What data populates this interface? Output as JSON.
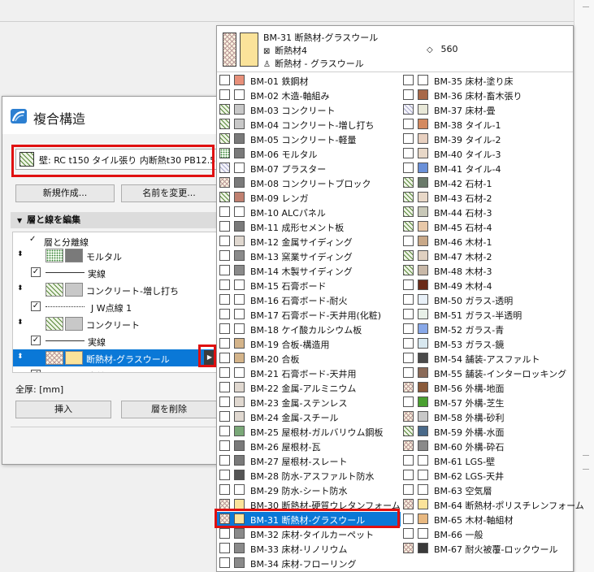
{
  "dialog": {
    "title": "複合構造",
    "structure_name": "壁: RC t150 タイル張り 内断熱t30 PB12.5",
    "new_button": "新規作成...",
    "rename_button": "名前を変更...",
    "section_label": "層と線を編集",
    "layers": [
      {
        "label": "層と分離線",
        "kind": "header"
      },
      {
        "label": "モルタル",
        "kind": "layer",
        "fill": "#7a7a7a",
        "hatch": "dots"
      },
      {
        "label": "実線",
        "kind": "line"
      },
      {
        "label": "コンクリート-増し打ち",
        "kind": "layer",
        "fill": "#c8c8c8",
        "hatch": "diag"
      },
      {
        "label": "J W点線 1",
        "kind": "line"
      },
      {
        "label": "コンクリート",
        "kind": "layer",
        "fill": "#c8c8c8",
        "hatch": "diag"
      },
      {
        "label": "実線",
        "kind": "line"
      },
      {
        "label": "断熱材-グラスウール",
        "kind": "layer",
        "fill": "#fbe39a",
        "hatch": "plus",
        "selected": true
      },
      {
        "label": "実線",
        "kind": "line"
      }
    ],
    "thickness_label": "全厚: [mm]",
    "insert_button": "挿入",
    "delete_button": "層を削除"
  },
  "popup": {
    "header": {
      "name": "BM-31  断熱材-グラスウール",
      "line2": "断熱材4",
      "line3": "断熱材 - グラスウール",
      "value": "560"
    },
    "left_column": [
      {
        "code": "BM-01",
        "name": "鉄鋼材",
        "color": "#e8907a",
        "hatch": "none"
      },
      {
        "code": "BM-02",
        "name": "木造-軸組み",
        "color": "#ffffff",
        "hatch": "none"
      },
      {
        "code": "BM-03",
        "name": "コンクリート",
        "color": "#c8c8c8",
        "hatch": "diag"
      },
      {
        "code": "BM-04",
        "name": "コンクリート-増し打ち",
        "color": "#c8c8c8",
        "hatch": "diag"
      },
      {
        "code": "BM-05",
        "name": "コンクリート-軽量",
        "color": "#7a7a7a",
        "hatch": "diag"
      },
      {
        "code": "BM-06",
        "name": "モルタル",
        "color": "#7a7a7a",
        "hatch": "dots"
      },
      {
        "code": "BM-07",
        "name": "プラスター",
        "color": "#ffffff",
        "hatch": "light"
      },
      {
        "code": "BM-08",
        "name": "コンクリートブロック",
        "color": "#7a7a7a",
        "hatch": "plus"
      },
      {
        "code": "BM-09",
        "name": "レンガ",
        "color": "#c08070",
        "hatch": "diag"
      },
      {
        "code": "BM-10",
        "name": "ALCパネル",
        "color": "#ffffff",
        "hatch": "none"
      },
      {
        "code": "BM-11",
        "name": "成形セメント板",
        "color": "#7a7a7a",
        "hatch": "none"
      },
      {
        "code": "BM-12",
        "name": "金属サイディング",
        "color": "#e0d8d0",
        "hatch": "none"
      },
      {
        "code": "BM-13",
        "name": "窯業サイディング",
        "color": "#8a8a8a",
        "hatch": "none"
      },
      {
        "code": "BM-14",
        "name": "木製サイディング",
        "color": "#8a8a8a",
        "hatch": "none"
      },
      {
        "code": "BM-15",
        "name": "石膏ボード",
        "color": "#ffffff",
        "hatch": "none"
      },
      {
        "code": "BM-16",
        "name": "石膏ボード-耐火",
        "color": "#ffffff",
        "hatch": "none"
      },
      {
        "code": "BM-17",
        "name": "石膏ボード-天井用(化粧)",
        "color": "#ffffff",
        "hatch": "none"
      },
      {
        "code": "BM-18",
        "name": "ケイ酸カルシウム板",
        "color": "#ffffff",
        "hatch": "none"
      },
      {
        "code": "BM-19",
        "name": "合板-構造用",
        "color": "#d4b48a",
        "hatch": "none"
      },
      {
        "code": "BM-20",
        "name": "合板",
        "color": "#d4b48a",
        "hatch": "none"
      },
      {
        "code": "BM-21",
        "name": "石膏ボード-天井用",
        "color": "#ffffff",
        "hatch": "none"
      },
      {
        "code": "BM-22",
        "name": "金属-アルミニウム",
        "color": "#e0d8d0",
        "hatch": "none"
      },
      {
        "code": "BM-23",
        "name": "金属-ステンレス",
        "color": "#e0d8d0",
        "hatch": "none"
      },
      {
        "code": "BM-24",
        "name": "金属-スチール",
        "color": "#e0d8d0",
        "hatch": "none"
      },
      {
        "code": "BM-25",
        "name": "屋根材-ガルバリウム鋼板",
        "color": "#7aa878",
        "hatch": "none"
      },
      {
        "code": "BM-26",
        "name": "屋根材-瓦",
        "color": "#7a7a7a",
        "hatch": "none"
      },
      {
        "code": "BM-27",
        "name": "屋根材-スレート",
        "color": "#7a7a7a",
        "hatch": "none"
      },
      {
        "code": "BM-28",
        "name": "防水-アスファルト防水",
        "color": "#555555",
        "hatch": "none"
      },
      {
        "code": "BM-29",
        "name": "防水-シート防水",
        "color": "#ffffff",
        "hatch": "none"
      },
      {
        "code": "BM-30",
        "name": "断熱材-硬質ウレタンフォーム",
        "color": "#fbe39a",
        "hatch": "plus"
      },
      {
        "code": "BM-31",
        "name": "断熱材-グラスウール",
        "color": "#fbe39a",
        "hatch": "plus",
        "selected": true
      },
      {
        "code": "BM-32",
        "name": "床材-タイルカーペット",
        "color": "#8a8a8a",
        "hatch": "none"
      },
      {
        "code": "BM-33",
        "name": "床材-リノリウム",
        "color": "#8a8a8a",
        "hatch": "none"
      },
      {
        "code": "BM-34",
        "name": "床材-フローリング",
        "color": "#8a8a8a",
        "hatch": "none"
      }
    ],
    "right_column": [
      {
        "code": "BM-35",
        "name": "床材-塗り床",
        "color": "#ffffff",
        "hatch": "none"
      },
      {
        "code": "BM-36",
        "name": "床材-畜木張り",
        "color": "#a86848",
        "hatch": "none"
      },
      {
        "code": "BM-37",
        "name": "床材-畳",
        "color": "#e8e8d8",
        "hatch": "light"
      },
      {
        "code": "BM-38",
        "name": "タイル-1",
        "color": "#d48a60",
        "hatch": "none"
      },
      {
        "code": "BM-39",
        "name": "タイル-2",
        "color": "#e8d0c0",
        "hatch": "none"
      },
      {
        "code": "BM-40",
        "name": "タイル-3",
        "color": "#e8d8c8",
        "hatch": "none"
      },
      {
        "code": "BM-41",
        "name": "タイル-4",
        "color": "#6a90d8",
        "hatch": "none"
      },
      {
        "code": "BM-42",
        "name": "石材-1",
        "color": "#6a7a6a",
        "hatch": "diag"
      },
      {
        "code": "BM-43",
        "name": "石材-2",
        "color": "#e8d8c8",
        "hatch": "diag"
      },
      {
        "code": "BM-44",
        "name": "石材-3",
        "color": "#c8c8b8",
        "hatch": "diag"
      },
      {
        "code": "BM-45",
        "name": "石材-4",
        "color": "#e8c8a8",
        "hatch": "diag"
      },
      {
        "code": "BM-46",
        "name": "木材-1",
        "color": "#c8a888",
        "hatch": "none"
      },
      {
        "code": "BM-47",
        "name": "木材-2",
        "color": "#e0d0c0",
        "hatch": "diag"
      },
      {
        "code": "BM-48",
        "name": "木材-3",
        "color": "#c8b8a8",
        "hatch": "diag"
      },
      {
        "code": "BM-49",
        "name": "木材-4",
        "color": "#6a2a18",
        "hatch": "none"
      },
      {
        "code": "BM-50",
        "name": "ガラス-透明",
        "color": "#e8f0f8",
        "hatch": "none"
      },
      {
        "code": "BM-51",
        "name": "ガラス-半透明",
        "color": "#e8f0e8",
        "hatch": "none"
      },
      {
        "code": "BM-52",
        "name": "ガラス-青",
        "color": "#88a8e8",
        "hatch": "none"
      },
      {
        "code": "BM-53",
        "name": "ガラス-鏡",
        "color": "#d8e8f0",
        "hatch": "none"
      },
      {
        "code": "BM-54",
        "name": "舗装-アスファルト",
        "color": "#4a4a4a",
        "hatch": "none"
      },
      {
        "code": "BM-55",
        "name": "舗装-インターロッキング",
        "color": "#8a6a58",
        "hatch": "none"
      },
      {
        "code": "BM-56",
        "name": "外構-地面",
        "color": "#8a5a3a",
        "hatch": "plus"
      },
      {
        "code": "BM-57",
        "name": "外構-芝生",
        "color": "#4aa030",
        "hatch": "none"
      },
      {
        "code": "BM-58",
        "name": "外構-砂利",
        "color": "#c8c8c8",
        "hatch": "plus"
      },
      {
        "code": "BM-59",
        "name": "外構-水面",
        "color": "#4a6a8a",
        "hatch": "diag"
      },
      {
        "code": "BM-60",
        "name": "外構-砕石",
        "color": "#8a8a8a",
        "hatch": "plus"
      },
      {
        "code": "BM-61",
        "name": "LGS-壁",
        "color": "#ffffff",
        "hatch": "none"
      },
      {
        "code": "BM-62",
        "name": "LGS-天井",
        "color": "#ffffff",
        "hatch": "none"
      },
      {
        "code": "BM-63",
        "name": "空気層",
        "color": "#ffffff",
        "hatch": "none"
      },
      {
        "code": "BM-64",
        "name": "断熱材-ポリスチレンフォーム",
        "color": "#fbe39a",
        "hatch": "plus"
      },
      {
        "code": "BM-65",
        "name": "木材-軸組材",
        "color": "#e8b880",
        "hatch": "none"
      },
      {
        "code": "BM-66",
        "name": "一般",
        "color": "#ffffff",
        "hatch": "none"
      },
      {
        "code": "BM-67",
        "name": "耐火被覆-ロックウール",
        "color": "#3a3a3a",
        "hatch": "plus"
      }
    ]
  },
  "colors": {
    "selection": "#0a78d7",
    "highlight": "#e01010"
  }
}
